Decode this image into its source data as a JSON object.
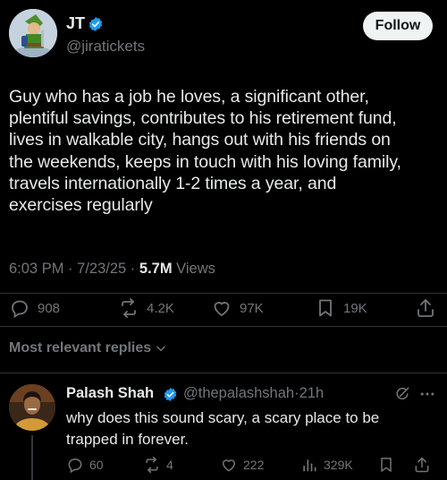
{
  "tweet": {
    "author_name": "JT",
    "author_handle": "@jiratickets",
    "follow_label": "Follow",
    "text": "Guy who has a job he loves, a significant other,\nplentiful savings, contributes to his retirement fund,\nlives in walkable city, hangs out with his friends on\nthe weekends, keeps in touch with his loving family,\ntravels internationally 1-2 times a year, and\nexercises regularly",
    "time": "6:03 PM",
    "date": "7/23/25",
    "views_count": "5.7M",
    "views_label": "Views",
    "sep": "·",
    "actions": {
      "replies": "908",
      "reposts": "4.2K",
      "likes": "97K",
      "bookmarks": "19K"
    }
  },
  "replies_section": {
    "label": "Most relevant replies"
  },
  "reply": {
    "author_name": "Palash Shah",
    "author_handle": "@thepalashshah",
    "sep": "·",
    "time": "21h",
    "text": "why does this sound scary, a scary place to be\ntrapped in forever.",
    "actions": {
      "replies": "60",
      "reposts": "4",
      "likes": "222",
      "views": "329K"
    }
  },
  "colors": {
    "background": "#000000",
    "text_primary": "#e7e9ea",
    "text_secondary": "#71767b",
    "verified": "#1d9bf0",
    "divider": "#2f3336"
  },
  "icons": [
    "verified-badge-icon",
    "reply-icon",
    "repost-icon",
    "like-icon",
    "bookmark-icon",
    "share-icon",
    "chevron-down-icon",
    "grok-icon",
    "more-icon",
    "views-icon"
  ]
}
